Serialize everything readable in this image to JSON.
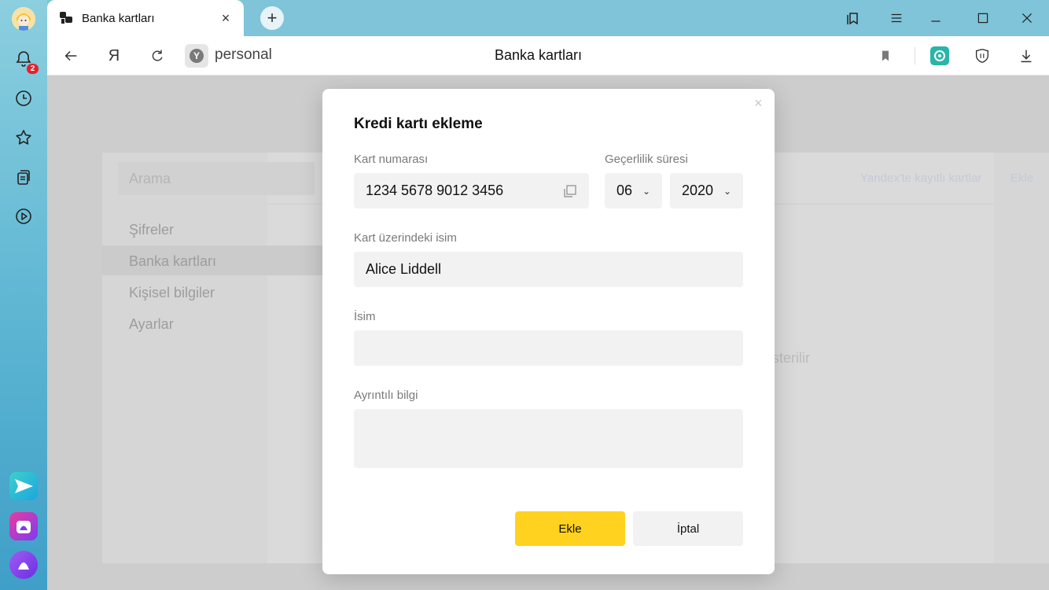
{
  "tab": {
    "title": "Banka kartları",
    "close": "×",
    "new_tab": "+"
  },
  "sidebar": {
    "notification_count": "2"
  },
  "addressbar": {
    "yandex_letter": "Я",
    "site_badge": "Y",
    "address": "personal",
    "page_title": "Banka kartları"
  },
  "page": {
    "search_placeholder": "Arama",
    "menu": [
      "Şifreler",
      "Banka kartları",
      "Kişisel bilgiler",
      "Ayarlar"
    ],
    "link_saved_cards": "Yandex'te kayıtlı kartlar",
    "link_add": "Ekle",
    "ghost_text": "österilir"
  },
  "modal": {
    "title": "Kredi kartı ekleme",
    "close": "×",
    "card_number_label": "Kart numarası",
    "card_number": "1234 5678 9012 3456",
    "expiry_label": "Geçerlilik süresi",
    "expiry_month": "06",
    "expiry_year": "2020",
    "name_on_card_label": "Kart üzerindeki isim",
    "name_on_card": "Alice Liddell",
    "name_label": "İsim",
    "name_value": "",
    "details_label": "Ayrıntılı bilgi",
    "details_value": "",
    "add_button": "Ekle",
    "cancel_button": "İptal"
  },
  "colors": {
    "accent_yellow": "#ffd21f",
    "sidebar_top": "#8ccfdf",
    "sidebar_bottom": "#3f9fc8",
    "badge_red": "#e5212a"
  }
}
